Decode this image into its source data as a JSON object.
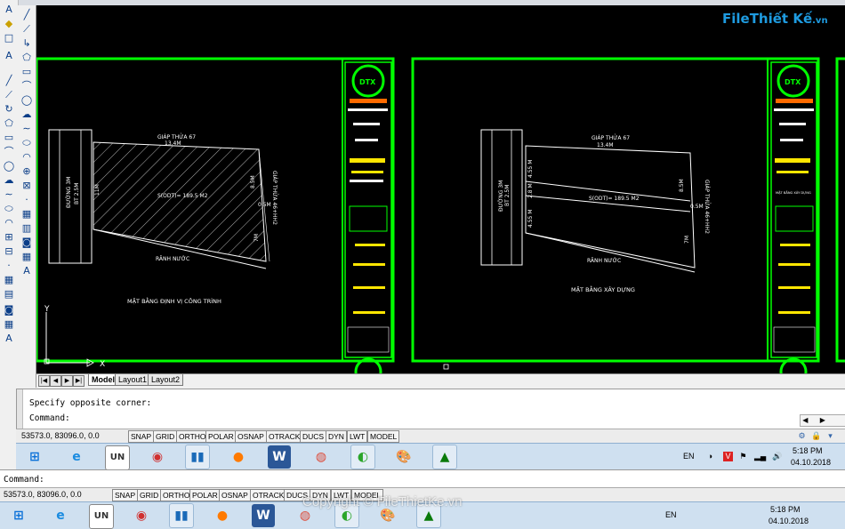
{
  "top_toolbar": {
    "present": true
  },
  "left_toolbar_icons": [
    "line-icon",
    "polyline-icon",
    "arc-icon",
    "polygon-icon",
    "rectangle-icon",
    "arc2-icon",
    "circle-icon",
    "revcloud-icon",
    "spline-icon",
    "ellipse-icon",
    "ellipse-arc-icon",
    "insert-block-icon",
    "make-block-icon",
    "point-icon",
    "hatch-icon",
    "gradient-icon",
    "region-icon",
    "table-icon",
    "mtext-icon"
  ],
  "left_toolbar_text_icon": "A",
  "canvas": {
    "background": "#000000",
    "frame_color": "#00ff00",
    "left_sheet": {
      "top_label": "GIÁP THỬA 67",
      "top_dim": "13.4M",
      "road_label_1": "ĐƯỜNG 3M",
      "road_label_2": "BT 2.5M",
      "side_dim_left": "11M",
      "area_label": "S(ODT)= 189.5 M2",
      "right_dim_top": "8.5M",
      "right_dim_mid": "0.5M",
      "right_dim_bot": "7M",
      "right_side_label": "GIÁP THỬA 46+HH2",
      "bottom_label": "RÃNH NƯỚC",
      "title": "MẶT BẰNG ĐỊNH VỊ CÔNG TRÌNH"
    },
    "right_sheet": {
      "top_label": "GIÁP THỬA 67",
      "top_dim": "13.4M",
      "road_label_1": "ĐƯỜNG 3M",
      "road_label_2": "BT 2.5M",
      "dim_a": "4.55 M",
      "dim_b": "2.8 M",
      "dim_c": "4.55 M",
      "area_label": "S(ODT)= 189.5 M2",
      "right_dim_top": "8.5M",
      "right_dim_mid": "0.5M",
      "right_dim_bot": "7M",
      "right_side_label": "GIÁP THỬA 46+HH2",
      "bottom_label": "RÃNH NƯỚC",
      "title": "MẶT BẰNG XÂY DỰNG"
    },
    "titleblock_logo": "DTX",
    "titleblock_small_label": "MẶT BẰNG XÂY DỰNG",
    "ucs_y": "Y",
    "ucs_x": "X"
  },
  "watermark_top": {
    "part1": "File",
    "part2": "Thiết Kế",
    "suffix": ".vn"
  },
  "layout_tabs": {
    "model": "Model",
    "layout1": "Layout1",
    "layout2": "Layout2"
  },
  "command": {
    "history": "Specify opposite corner:",
    "prompt": "Command:"
  },
  "status_bar": {
    "coords": "53573.0, 83096.0, 0.0",
    "buttons": [
      "SNAP",
      "GRID",
      "ORTHO",
      "POLAR",
      "OSNAP",
      "OTRACK",
      "DUCS",
      "DYN",
      "LWT",
      "MODEL"
    ]
  },
  "taskbar": {
    "language": "EN",
    "time": "5:18 PM",
    "date": "04.10.2018",
    "apps": [
      "start-button",
      "ie-icon",
      "unikey-icon",
      "media-icon",
      "files-icon",
      "firefox-icon",
      "word-icon",
      "chrome-icon",
      "autocad-classic-icon",
      "paint-icon",
      "autocad-icon"
    ]
  },
  "duplicate": {
    "command_prompt": "Command:",
    "coords": "53573.0, 83096.0, 0.0",
    "watermark": "Copyright © FileThietKe.vn"
  }
}
